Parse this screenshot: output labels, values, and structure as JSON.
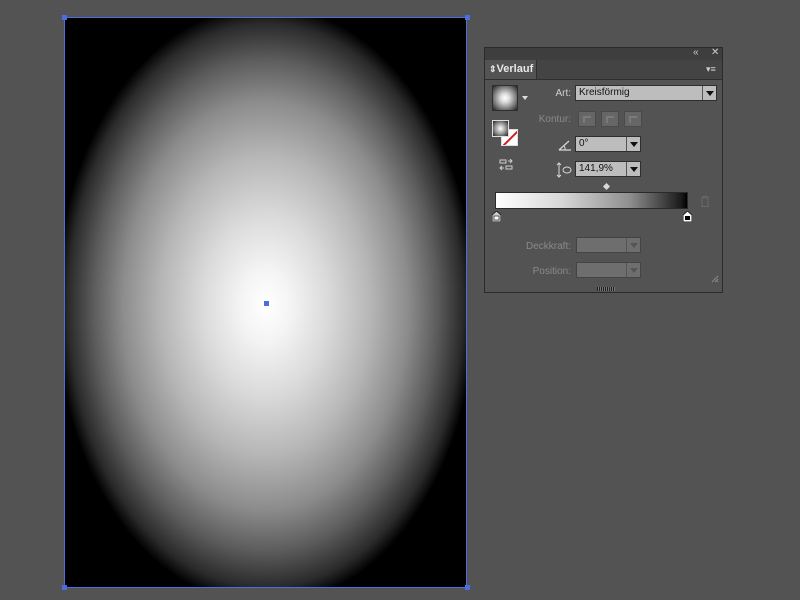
{
  "panel": {
    "title": "Verlauf",
    "collapse_icon": "double-chevron-left-icon",
    "close_icon": "close-icon",
    "menu_icon": "panel-menu-icon"
  },
  "gradient_options": {
    "type_label": "Art:",
    "type_value": "Kreisförmig",
    "stroke_label": "Kontur:",
    "angle_value": "0°",
    "aspect_ratio_value": "141,9%",
    "opacity_label": "Deckkraft:",
    "opacity_value": "",
    "location_label": "Position:",
    "location_value": ""
  },
  "gradient": {
    "start_color": "#ffffff",
    "end_color": "#000000",
    "midpoint_percent": 50
  },
  "colors": {
    "canvas_bg": "#535353",
    "artboard_border": "#4a6ee0",
    "stroke_none_red": "#d01e1e"
  }
}
